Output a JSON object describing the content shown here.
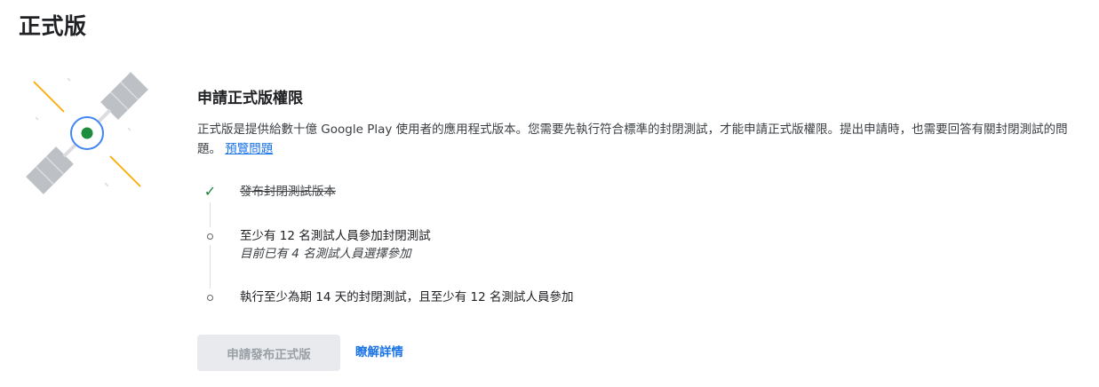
{
  "page": {
    "title": "正式版"
  },
  "card": {
    "title": "申請正式版權限",
    "description": "正式版是提供給數十億 Google Play 使用者的應用程式版本。您需要先執行符合標準的封閉測試，才能申請正式版權限。提出申請時，也需要回答有關封閉測試的問題。",
    "preview_link": "預覽問題"
  },
  "steps": [
    {
      "label": "發布封閉測試版本",
      "status": "completed",
      "icon": "check-icon"
    },
    {
      "label": "至少有 12 名測試人員參加封閉測試",
      "sub": "目前已有 4 名測試人員選擇參加",
      "status": "pending",
      "icon": "circle-icon"
    },
    {
      "label": "執行至少為期 14 天的封閉測試，且至少有 12 名測試人員參加",
      "status": "pending",
      "icon": "circle-icon"
    }
  ],
  "actions": {
    "apply_label": "申請發布正式版",
    "apply_enabled": false,
    "learn_more_label": "瞭解詳情"
  },
  "colors": {
    "accent": "#1a73e8",
    "success": "#188038",
    "satellite_green": "#1e8e3e",
    "satellite_yellow": "#f9ab00",
    "panel_gray": "#bdc1c6",
    "disabled_bg": "#e8eaed",
    "disabled_text": "#9aa0a6"
  }
}
